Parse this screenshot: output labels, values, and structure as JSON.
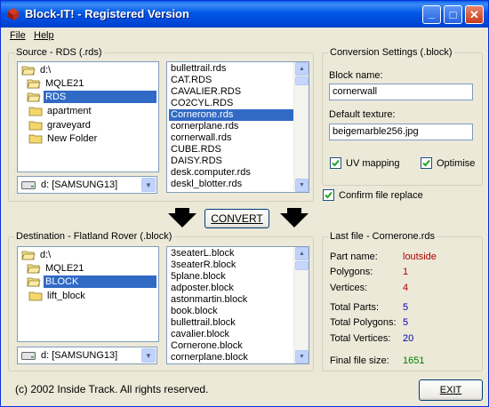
{
  "window": {
    "title": "Block-IT! - Registered Version",
    "minimize": "_",
    "maximize": "□",
    "close": "✕"
  },
  "menu": [
    {
      "label": "File"
    },
    {
      "label": "Help"
    }
  ],
  "source": {
    "group_label": "Source - RDS (.rds)",
    "tree": [
      "d:\\",
      "MQLE21",
      "RDS",
      "apartment",
      "graveyard",
      "New Folder"
    ],
    "tree_selected": "RDS",
    "files": [
      "bullettrail.rds",
      "CAT.RDS",
      "CAVALIER.RDS",
      "CO2CYL.RDS",
      "Cornerone.rds",
      "cornerplane.rds",
      "cornerwall.rds",
      "CUBE.RDS",
      "DAISY.RDS",
      "desk.computer.rds",
      "deskl_blotter.rds"
    ],
    "file_selected": "Cornerone.rds",
    "drive": "d: [SAMSUNG13]"
  },
  "convert_label": "CONVERT",
  "settings": {
    "group_label": "Conversion Settings (.block)",
    "block_name_label": "Block name:",
    "block_name_value": "cornerwall",
    "texture_label": "Default texture:",
    "texture_value": "beigemarble256.jpg",
    "uv_label": "UV mapping",
    "uv_checked": true,
    "optimise_label": "Optimise",
    "optimise_checked": true,
    "confirm_label": "Confirm file replace",
    "confirm_checked": true
  },
  "destination": {
    "group_label": "Destination - Flatland Rover (.block)",
    "tree": [
      "d:\\",
      "MQLE21",
      "BLOCK",
      "lift_block"
    ],
    "tree_selected": "BLOCK",
    "files": [
      "3seaterL.block",
      "3seaterR.block",
      "5plane.block",
      "adposter.block",
      "astonmartin.block",
      "book.block",
      "bullettrail.block",
      "cavalier.block",
      "Cornerone.block",
      "cornerplane.block"
    ],
    "drive": "d: [SAMSUNG13]"
  },
  "lastfile": {
    "group_label": "Last file - Cornerone.rds",
    "part_name_label": "Part name:",
    "part_name_value": "loutside",
    "polygons_label": "Polygons:",
    "polygons_value": "1",
    "vertices_label": "Vertices:",
    "vertices_value": "4",
    "total_parts_label": "Total Parts:",
    "total_parts_value": "5",
    "total_polygons_label": "Total Polygons:",
    "total_polygons_value": "5",
    "total_vertices_label": "Total Vertices:",
    "total_vertices_value": "20",
    "final_size_label": "Final file size:",
    "final_size_value": "1651"
  },
  "footer": "(c) 2002 Inside Track. All rights reserved.",
  "exit_label": "EXIT",
  "colors": {
    "red_value": "#b00000",
    "blue_value": "#0000b0",
    "green_value": "#008000",
    "selection": "#316ac5"
  }
}
